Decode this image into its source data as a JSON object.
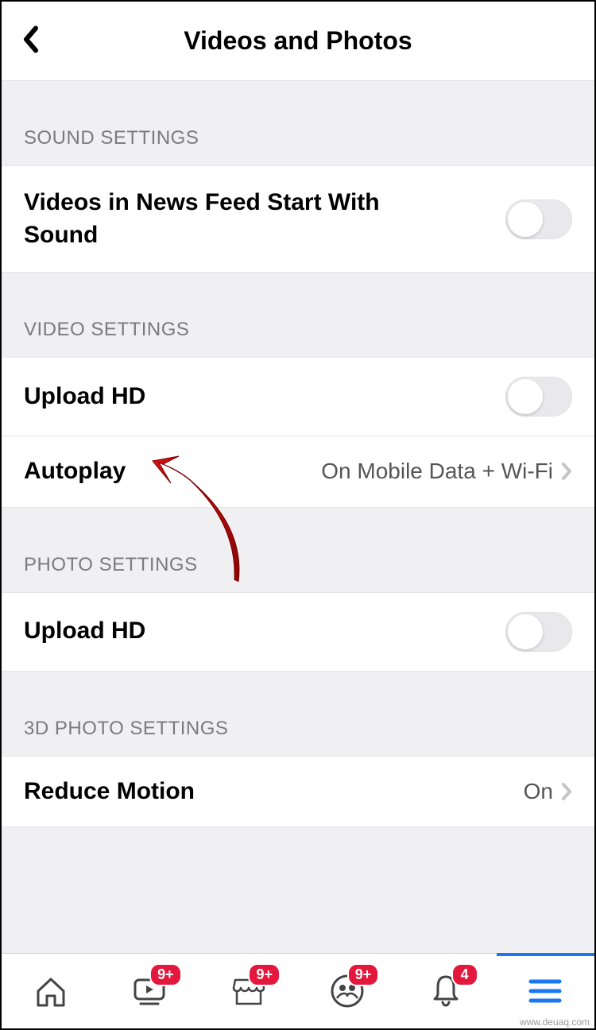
{
  "header": {
    "title": "Videos and Photos"
  },
  "sections": {
    "sound": {
      "header": "SOUND SETTINGS",
      "row1_label": "Videos in News Feed Start With Sound"
    },
    "video": {
      "header": "VIDEO SETTINGS",
      "upload_hd_label": "Upload HD",
      "autoplay_label": "Autoplay",
      "autoplay_value": "On Mobile Data + Wi-Fi"
    },
    "photo": {
      "header": "PHOTO SETTINGS",
      "upload_hd_label": "Upload HD"
    },
    "three_d": {
      "header": "3D PHOTO SETTINGS",
      "reduce_motion_label": "Reduce Motion",
      "reduce_motion_value": "On"
    }
  },
  "tabbar": {
    "home_badge": "",
    "watch_badge": "9+",
    "marketplace_badge": "9+",
    "groups_badge": "9+",
    "notifications_badge": "4"
  },
  "watermark": "www.deuaq.com"
}
